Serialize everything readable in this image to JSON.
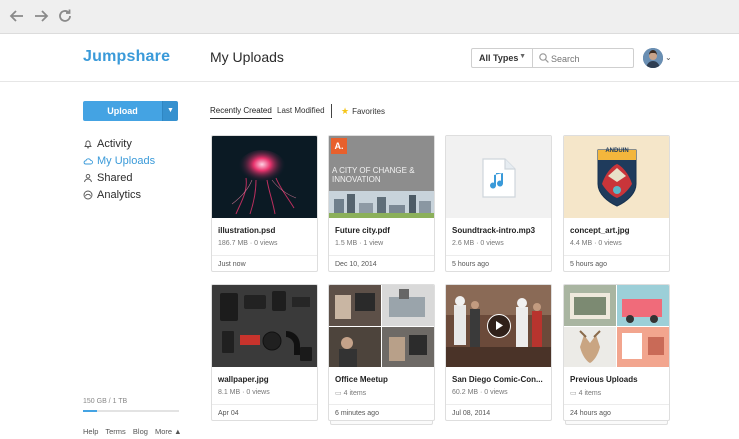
{
  "app": {
    "logo": "Jumpshare",
    "page_title": "My Uploads",
    "accent_color": "#3a9ad9"
  },
  "browser": {
    "back_icon": "arrow-left-icon",
    "forward_icon": "arrow-right-icon",
    "reload_icon": "reload-icon"
  },
  "toolbar": {
    "type_filter": "All Types",
    "search_placeholder": "Search"
  },
  "sidebar": {
    "upload_label": "Upload",
    "items": [
      {
        "label": "Activity",
        "icon": "bell-icon",
        "active": false
      },
      {
        "label": "My Uploads",
        "icon": "cloud-icon",
        "active": true
      },
      {
        "label": "Shared",
        "icon": "users-icon",
        "active": false
      },
      {
        "label": "Analytics",
        "icon": "gauge-icon",
        "active": false
      }
    ],
    "storage": "150 GB / 1 TB",
    "storage_fraction": 0.15,
    "footer_links": [
      "Help",
      "Terms",
      "Blog",
      "More ▲"
    ]
  },
  "tabs": {
    "recent": "Recently Created",
    "modified": "Last Modified",
    "favorites": "Favorites"
  },
  "files": [
    {
      "name": "illustration.psd",
      "meta": "186.7 MB · 0 views",
      "time": "Just now"
    },
    {
      "name": "Future city.pdf",
      "meta": "1.5 MB · 1 view",
      "time": "Dec 10, 2014",
      "thumb_text": "A CITY OF CHANGE & INNOVATION",
      "thumb_badge": "A."
    },
    {
      "name": "Soundtrack-intro.mp3",
      "meta": "2.6 MB · 0 views",
      "time": "5 hours ago"
    },
    {
      "name": "concept_art.jpg",
      "meta": "4.4 MB · 0 views",
      "time": "5 hours ago",
      "thumb_text": "ANDUIN"
    },
    {
      "name": "wallpaper.jpg",
      "meta": "8.1 MB · 0 views",
      "time": "Apr 04"
    },
    {
      "name": "Office Meetup",
      "meta": "4 items",
      "time": "6 minutes ago"
    },
    {
      "name": "San Diego Comic-Con...",
      "meta": "60.2 MB · 0 views",
      "time": "Jul 08, 2014"
    },
    {
      "name": "Previous Uploads",
      "meta": "4 items",
      "time": "24 hours ago"
    }
  ]
}
